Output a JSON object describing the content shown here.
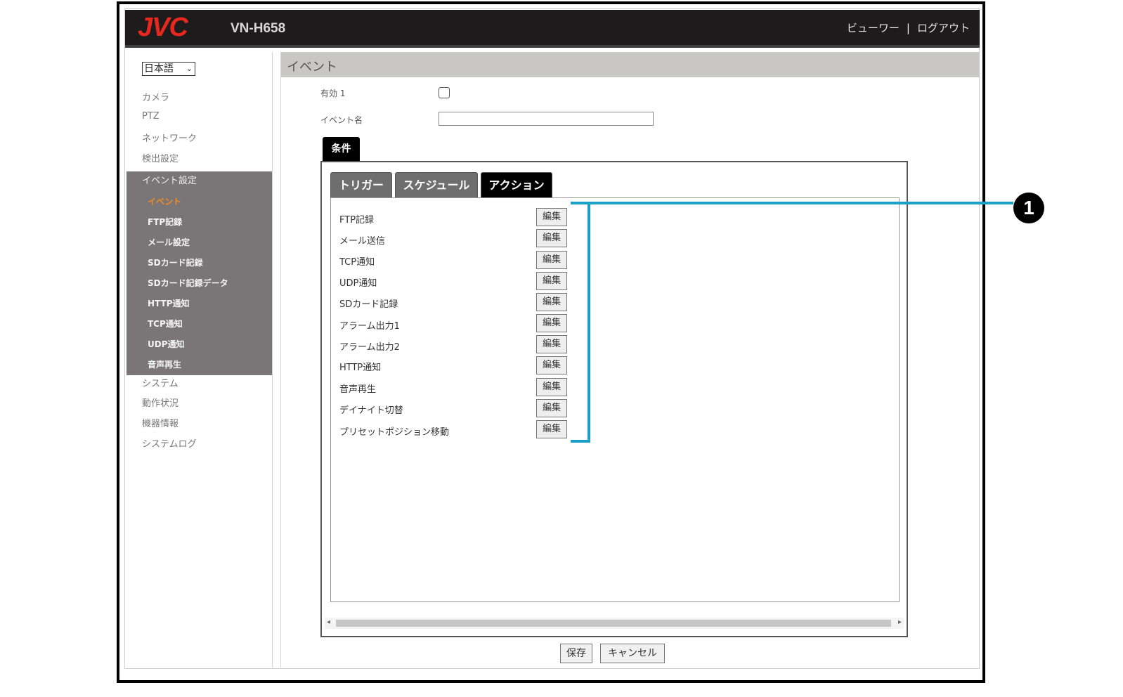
{
  "header": {
    "logo": "JVC",
    "model": "VN-H658",
    "viewer_link": "ビューワー",
    "separator": "|",
    "logout_link": "ログアウト"
  },
  "sidebar": {
    "language": "日本語",
    "items_top": [
      "カメラ",
      "PTZ",
      "ネットワーク",
      "検出設定"
    ],
    "group_head": "イベント設定",
    "sub_items": [
      "イベント",
      "FTP記録",
      "メール設定",
      "SDカード記録",
      "SDカード記録データ",
      "HTTP通知",
      "TCP通知",
      "UDP通知",
      "音声再生"
    ],
    "active_sub": "イベント",
    "items_bottom": [
      "システム",
      "動作状況",
      "機器情報",
      "システムログ"
    ]
  },
  "main": {
    "title": "イベント",
    "enable_label": "有効 1",
    "enable_checked": false,
    "event_name_label": "イベント名",
    "event_name_value": "",
    "condition_tab": "条件",
    "tabs": [
      "トリガー",
      "スケジュール",
      "アクション"
    ],
    "active_tab": "アクション",
    "edit_label": "編集",
    "actions": [
      "FTP記録",
      "メール送信",
      "TCP通知",
      "UDP通知",
      "SDカード記録",
      "アラーム出力1",
      "アラーム出力2",
      "HTTP通知",
      "音声再生",
      "デイナイト切替",
      "プリセットポジション移動"
    ],
    "save_button": "保存",
    "cancel_button": "キャンセル"
  },
  "callout": {
    "number": "1",
    "color": "#1aa0c8"
  },
  "colors": {
    "logo_red": "#e8281e",
    "active_orange": "#f28c1e",
    "topbar": "#1e1b1c",
    "sidebar_group": "#7a7677"
  }
}
